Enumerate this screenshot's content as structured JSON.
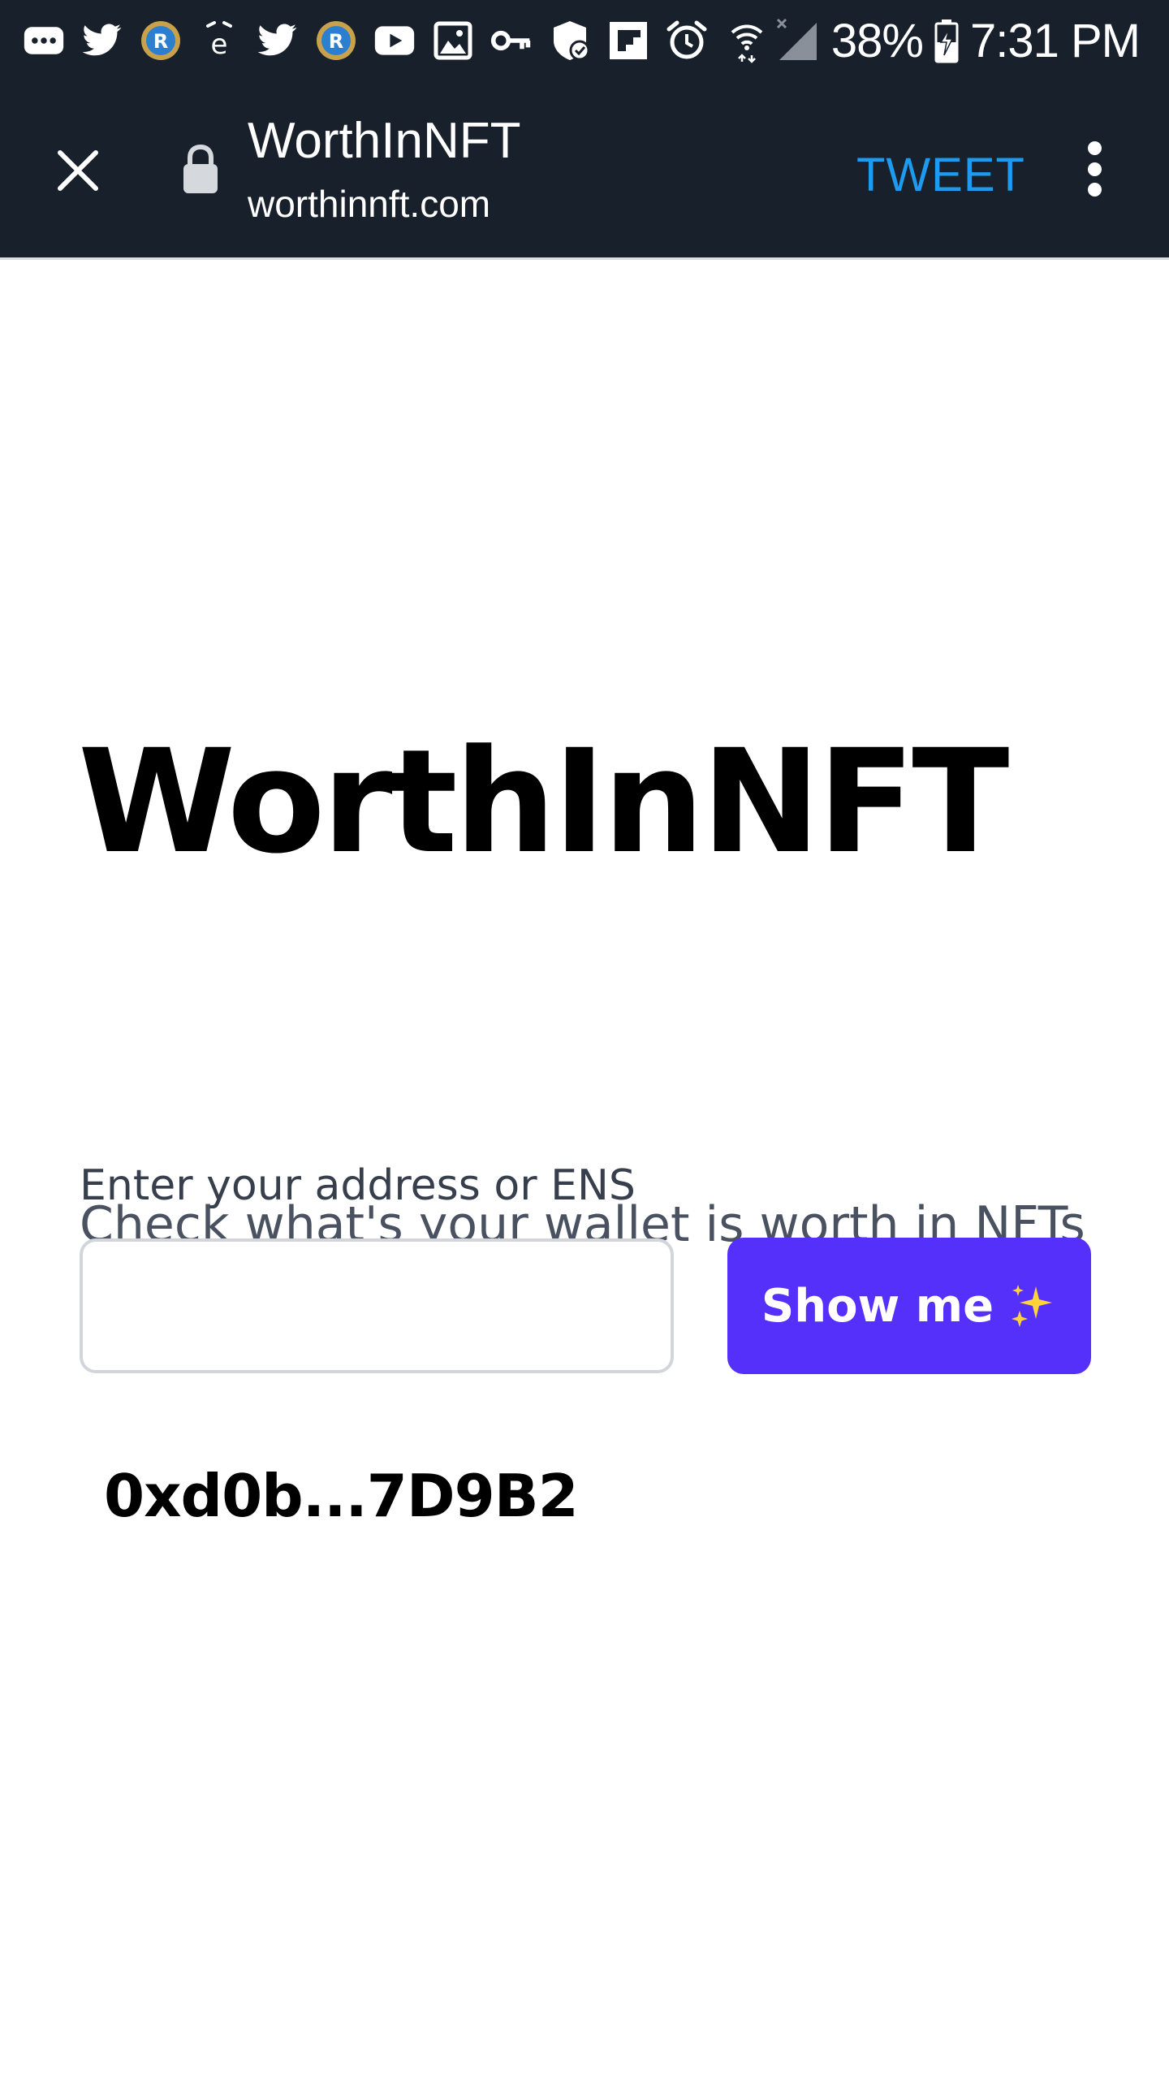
{
  "status_bar": {
    "notification_icons": [
      "more-messages-icon",
      "twitter-icon",
      "app-badge-icon",
      "ebay-icon",
      "twitter-icon",
      "app-badge-icon",
      "youtube-icon",
      "gallery-icon",
      "key-icon",
      "app-check-icon",
      "flipboard-icon",
      "alarm-icon"
    ],
    "wifi_icon": "wifi-icon",
    "signal_icon": "signal-icon",
    "battery_percent": "38%",
    "battery_icon": "battery-charging-icon",
    "time": "7:31 PM"
  },
  "toolbar": {
    "close_icon": "close-icon",
    "lock_icon": "lock-icon",
    "title": "WorthInNFT",
    "url": "worthinnft.com",
    "action_label": "TWEET",
    "menu_icon": "more-vert-icon",
    "action_color": "#1d9bf0",
    "background_color": "#18202b"
  },
  "page": {
    "title": "WorthInNFT",
    "subtitle": "Check what's your wallet is worth in NFTs",
    "address_label": "Enter your address or ENS",
    "address_input": {
      "value": "",
      "placeholder": ""
    },
    "submit_label": "Show me",
    "submit_icon": "sparkles-icon",
    "submit_color": "#5530fb",
    "wallet_address": "0xd0b...7D9B2"
  }
}
